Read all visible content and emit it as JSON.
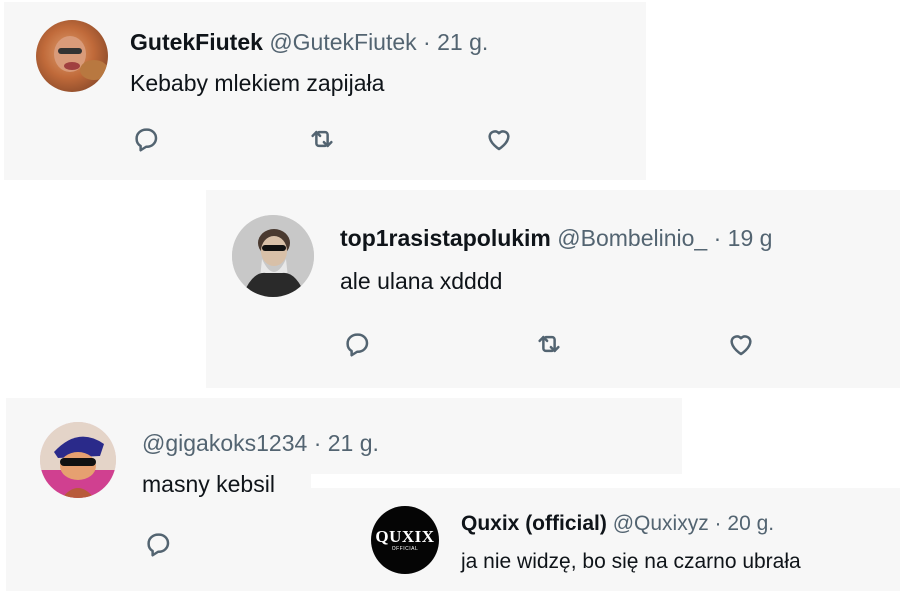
{
  "tweets": [
    {
      "display_name": "GutekFiutek",
      "handle": "@GutekFiutek",
      "separator": "·",
      "time": "21 g.",
      "text": "Kebaby mlekiem zapijała",
      "avatar_icon": "avatar-photo-icon"
    },
    {
      "display_name": "top1rasistapolukim",
      "handle": "@Bombelinio_",
      "separator": "·",
      "time": "19 g",
      "text": "ale ulana xdddd",
      "avatar_icon": "avatar-photo-icon"
    },
    {
      "display_name": "",
      "handle": "@gigakoks1234",
      "separator": "·",
      "time": "21 g.",
      "text": "masny kebsil",
      "avatar_icon": "avatar-photo-icon"
    },
    {
      "display_name": "Quxix (official)",
      "handle": "@Quxixyz",
      "separator": "·",
      "time": "20 g.",
      "text": "ja nie widzę, bo się na czarno ubrała",
      "avatar_logo_text": "QUXIX",
      "avatar_logo_sub": "OFFICIAL"
    }
  ],
  "icons": {
    "reply": "reply-icon",
    "retweet": "retweet-icon",
    "like": "like-icon"
  },
  "colors": {
    "card_background": "#f7f7f7",
    "text_primary": "#0f1419",
    "text_secondary": "#536471"
  }
}
